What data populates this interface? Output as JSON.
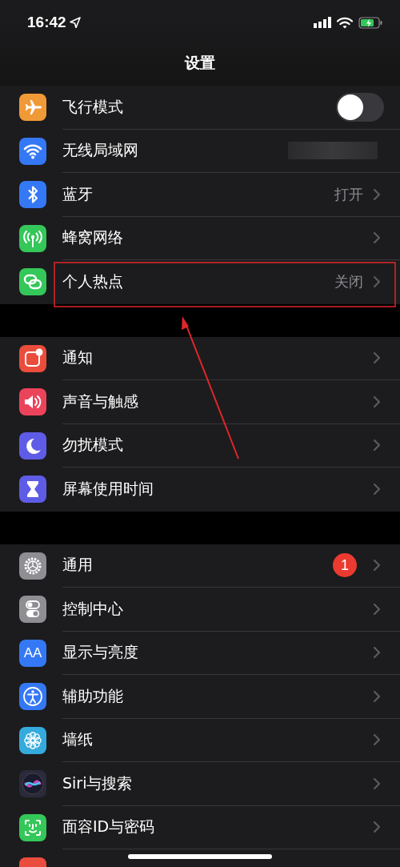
{
  "status_bar": {
    "time": "16:42",
    "battery_charging": true
  },
  "nav_bar": {
    "title": "设置"
  },
  "groups": [
    {
      "rows": [
        {
          "kind": "airplane",
          "color": "#f09a37",
          "label": "飞行模式",
          "toggle": {
            "on": false
          },
          "chevron": false
        },
        {
          "kind": "wifi",
          "color": "#3478f6",
          "label": "无线局域网",
          "redacted": true,
          "chevron": false
        },
        {
          "kind": "bluetooth",
          "color": "#3478f6",
          "label": "蓝牙",
          "value": "打开",
          "chevron": true
        },
        {
          "kind": "antenna",
          "color": "#34c759",
          "label": "蜂窝网络",
          "chevron": true
        },
        {
          "kind": "link",
          "color": "#34c759",
          "label": "个人热点",
          "value": "关闭",
          "chevron": true
        }
      ]
    },
    {
      "rows": [
        {
          "kind": "notification",
          "color": "#eb4d3d",
          "label": "通知",
          "chevron": true
        },
        {
          "kind": "speaker",
          "color": "#eb445a",
          "label": "声音与触感",
          "chevron": true
        },
        {
          "kind": "moon",
          "color": "#5e5ce6",
          "label": "勿扰模式",
          "chevron": true
        },
        {
          "kind": "hourglass",
          "color": "#5e5ce6",
          "label": "屏幕使用时间",
          "chevron": true
        }
      ]
    },
    {
      "rows": [
        {
          "kind": "gear",
          "color": "#8e8e93",
          "label": "通用",
          "badge": "1",
          "chevron": true
        },
        {
          "kind": "switches",
          "color": "#8e8e93",
          "label": "控制中心",
          "chevron": true
        },
        {
          "kind": "text",
          "icon_text": "AA",
          "color": "#3478f6",
          "label": "显示与亮度",
          "chevron": true
        },
        {
          "kind": "person",
          "color": "#3478f6",
          "label": "辅助功能",
          "chevron": true
        },
        {
          "kind": "flower",
          "color": "#35aadc",
          "label": "墙纸",
          "chevron": true
        },
        {
          "kind": "orb",
          "color": "#2a2a3a",
          "label": "Siri与搜索",
          "chevron": true
        },
        {
          "kind": "face",
          "color": "#34c759",
          "label": "面容ID与密码",
          "chevron": true
        },
        {
          "kind": "blank",
          "color": "#eb4d3d",
          "chevron": false
        }
      ]
    }
  ],
  "annotations": {
    "highlight_box": true,
    "arrow": true
  }
}
